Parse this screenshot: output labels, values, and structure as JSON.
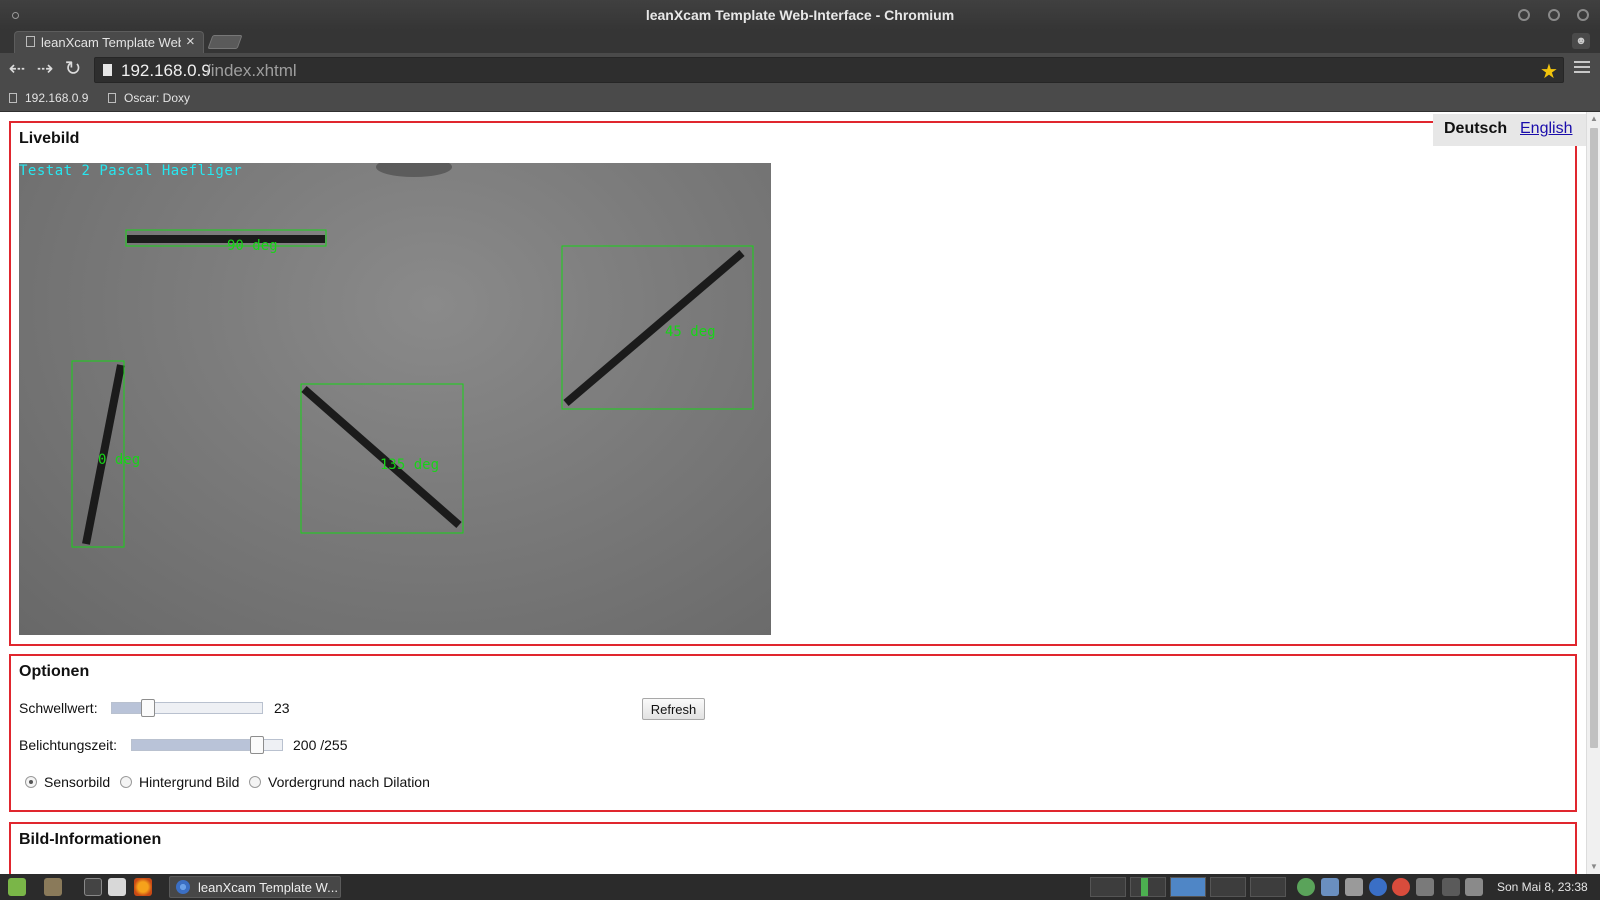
{
  "window": {
    "title": "leanXcam Template Web-Interface - Chromium"
  },
  "tabs": [
    {
      "label": "leanXcam Template Web-Interface",
      "close": "×"
    }
  ],
  "toolbar": {
    "url_host": "192.168.0.9",
    "url_path": "/index.xhtml"
  },
  "bookmarks": [
    {
      "label": "192.168.0.9"
    },
    {
      "label": "Oscar: Doxy"
    }
  ],
  "language": {
    "current": "Deutsch",
    "other": "English"
  },
  "livebild": {
    "heading": "Livebild",
    "caption": "Testat 2 Pascal Haefliger",
    "detections": [
      {
        "label": "90 deg"
      },
      {
        "label": "45 deg"
      },
      {
        "label": "0 deg"
      },
      {
        "label": "135 deg"
      }
    ],
    "box_color": "#18d418"
  },
  "optionen": {
    "heading": "Optionen",
    "schwellwert": {
      "label": "Schwellwert:",
      "value": "23",
      "fraction": 0.27
    },
    "belichtungszeit": {
      "label": "Belichtungszeit:",
      "value": "200 /255",
      "fraction": 0.82
    },
    "refresh_label": "Refresh",
    "radios": [
      {
        "label": "Sensorbild",
        "checked": true
      },
      {
        "label": "Hintergrund Bild",
        "checked": false
      },
      {
        "label": "Vordergrund nach Dilation",
        "checked": false
      }
    ]
  },
  "bild_info": {
    "heading": "Bild-Informationen"
  },
  "taskbar": {
    "task_label": "leanXcam Template W...",
    "clock": "Son Mai  8, 23:38"
  },
  "colors": {
    "panel_border": "#e0262e",
    "link": "#1a0dab",
    "caption": "#27e6ef"
  }
}
